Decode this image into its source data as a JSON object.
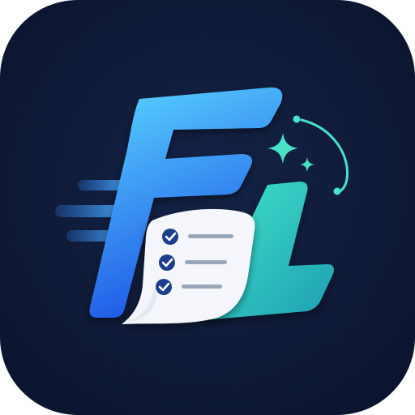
{
  "app_icon": {
    "icon": "fl-checklist-app-icon",
    "lettering": "FL",
    "colors": {
      "background": "#0d1733",
      "f_gradient_start": "#5ad6ff",
      "f_gradient_end": "#1e56e6",
      "l_gradient_start": "#3fe4c9",
      "l_gradient_end": "#1f9fb3",
      "accent_teal": "#47e2c8",
      "check_circle": "#1c3f8c",
      "list_line": "#9aa7b8",
      "paper": "#f4f6fb"
    },
    "checklist": {
      "items": [
        {
          "checked": true
        },
        {
          "checked": true
        },
        {
          "checked": true
        }
      ]
    },
    "decorations": {
      "speed_lines": 3,
      "sparkles": 2,
      "orbit_arc": true
    }
  }
}
